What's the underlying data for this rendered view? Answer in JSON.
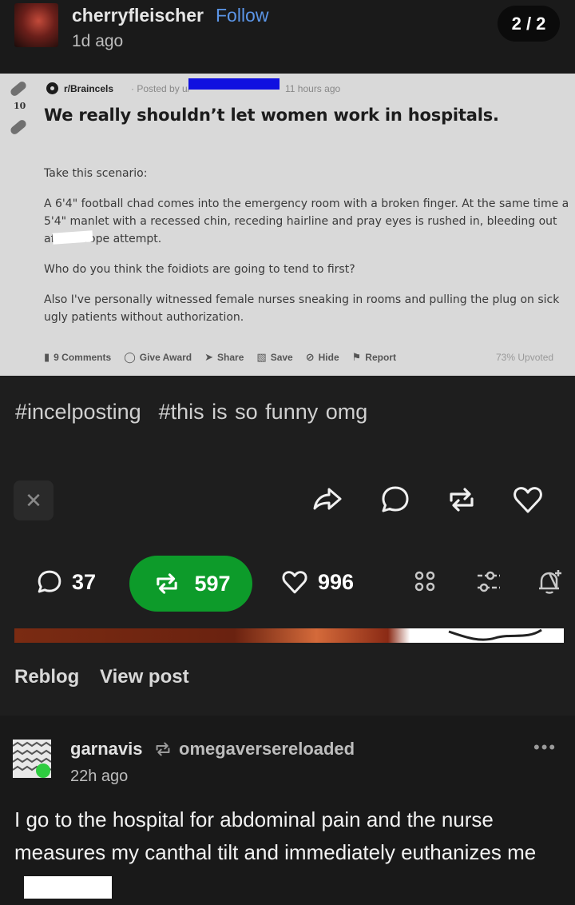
{
  "header": {
    "username": "cherryfleischer",
    "follow_label": "Follow",
    "time": "1d ago",
    "page_indicator": "2 / 2"
  },
  "reddit_post": {
    "vote_count": "10",
    "subreddit": "r/Braincels",
    "posted_by": "· Posted by u/",
    "time": "11 hours ago",
    "title": "We really shouldn’t let women work in hospitals.",
    "paragraphs": [
      "Take this scenario:",
      "A 6'4\" football chad comes into the emergency room with a broken finger. At the same time a 5'4\" manlet with a recessed chin, receding hairline and pray eyes is rushed in, bleeding out after a rope attempt.",
      "Who do you think the foidiots are going to tend to first?",
      "Also I've personally witnessed female nurses sneaking in rooms and pulling the plug on sick ugly patients without authorization."
    ],
    "actions": {
      "comments": "9 Comments",
      "award": "Give Award",
      "share": "Share",
      "save": "Save",
      "hide": "Hide",
      "report": "Report"
    },
    "upvoted": "73% Upvoted"
  },
  "tags": [
    "#incelposting",
    "#this is so funny omg"
  ],
  "stats": {
    "comments": "37",
    "reblogs": "597",
    "likes": "996"
  },
  "links": {
    "reblog": "Reblog",
    "view_post": "View post"
  },
  "reblog_post": {
    "username": "garnavis",
    "reblogged_from": "omegaversereloaded",
    "time": "22h ago",
    "more": "•••",
    "text": "I go to the hospital for abdominal pain and the nurse measures my canthal tilt and immediately euthanizes me"
  },
  "colors": {
    "background": "#1e1e1e",
    "accent_follow": "#5b95e6",
    "reblog_green": "#0d9b2a",
    "reddit_bg": "#d9d9d9",
    "redaction_blue": "#1010e0"
  }
}
